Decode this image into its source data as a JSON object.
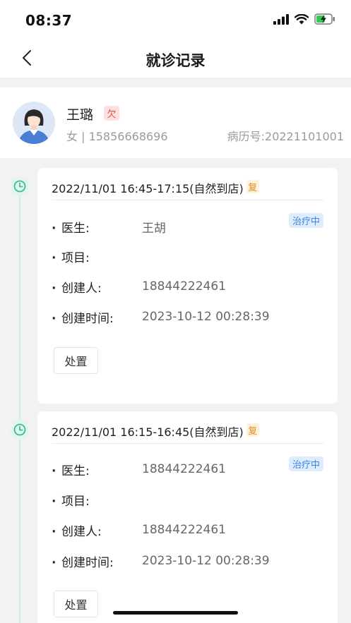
{
  "status_bar": {
    "time": "08:37"
  },
  "nav": {
    "title": "就诊记录"
  },
  "patient": {
    "name": "王璐",
    "owe_badge": "欠",
    "gender_phone": "女 | 15856668696",
    "record_no": "病历号:20221101001"
  },
  "labels": {
    "doctor": "医生:",
    "project": "项目:",
    "creator": "创建人:",
    "created_time": "创建时间:",
    "bullet": "·"
  },
  "records": [
    {
      "visit_time": "2022/11/01 16:45-17:15(自然到店)",
      "return_badge": "复",
      "status": "治疗中",
      "doctor": "王胡",
      "project": "",
      "creator": "18844222461",
      "created_time": "2023-10-12 00:28:39",
      "action": "处置"
    },
    {
      "visit_time": "2022/11/01 16:15-16:45(自然到店)",
      "return_badge": "复",
      "status": "治疗中",
      "doctor": "18844222461",
      "project": "",
      "creator": "18844222461",
      "created_time": "2023-10-12 00:28:39",
      "action": "处置"
    }
  ],
  "colors": {
    "accent_green": "#3dbd93",
    "status_blue": "#3a86e3",
    "owe_red": "#e34a4a",
    "return_orange": "#e38a1f"
  }
}
